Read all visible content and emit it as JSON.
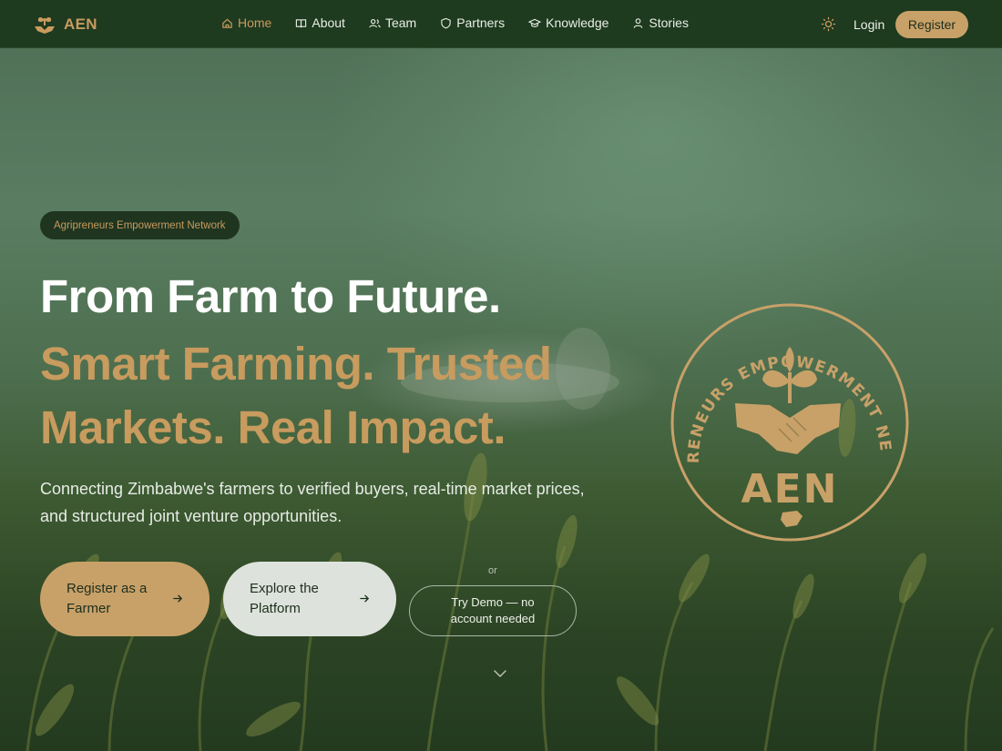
{
  "brand": {
    "name": "AEN",
    "logo_icon": "sprout-hands-icon"
  },
  "nav": {
    "items": [
      {
        "label": "Home",
        "icon": "home-icon",
        "active": true
      },
      {
        "label": "About",
        "icon": "book-icon",
        "active": false
      },
      {
        "label": "Team",
        "icon": "users-icon",
        "active": false
      },
      {
        "label": "Partners",
        "icon": "shield-icon",
        "active": false
      },
      {
        "label": "Knowledge",
        "icon": "graduation-cap-icon",
        "active": false
      },
      {
        "label": "Stories",
        "icon": "user-icon",
        "active": false
      }
    ],
    "theme_icon": "sun-icon",
    "login_label": "Login",
    "register_label": "Register"
  },
  "hero": {
    "badge": "Agripreneurs Empowerment Network",
    "headline_line1": "From Farm to Future.",
    "headline_line2": "Smart Farming. Trusted Markets. Real Impact.",
    "subtext": "Connecting Zimbabwe's farmers to verified buyers, real-time market prices, and structured joint venture opportunities.",
    "cta_primary": "Register as a Farmer",
    "cta_secondary": "Explore the Platform",
    "or_label": "or",
    "demo_label": "Try Demo — no account needed",
    "scroll_icon": "chevron-down-icon"
  },
  "emblem": {
    "arc_text": "AGRIPRENEURS EMPOWERMENT NETWORK",
    "initials": "AEN",
    "icon": "handshake-sprout-icon"
  },
  "colors": {
    "accent_gold": "#c8a169",
    "nav_bg": "#1e3a1f",
    "hero_green": "#4d6e4e",
    "text_light": "#e7ece4"
  }
}
